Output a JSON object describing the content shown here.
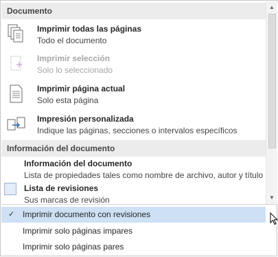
{
  "sections": [
    {
      "header": "Documento",
      "items": [
        {
          "title": "Imprimir todas las páginas",
          "desc": "Todo el documento",
          "icon": "pages-stack-icon",
          "disabled": false
        },
        {
          "title": "Imprimir selección",
          "desc": "Solo lo seleccionado",
          "icon": "selection-icon",
          "disabled": true
        },
        {
          "title": "Imprimir página actual",
          "desc": "Solo esta página",
          "icon": "single-page-icon",
          "disabled": false
        },
        {
          "title": "Impresión personalizada",
          "desc": "Indique las páginas, secciones o intervalos específicos",
          "icon": "custom-pages-icon",
          "disabled": false
        }
      ]
    },
    {
      "header": "Información del documento",
      "items": [
        {
          "title": "Información del documento",
          "desc": "Lista de propiedades tales como nombre de archivo, autor y título"
        },
        {
          "title": "Lista de revisiones",
          "desc": "Sus marcas de revisión"
        }
      ]
    }
  ],
  "options": [
    {
      "label": "Imprimir documento con revisiones",
      "checked": true
    },
    {
      "label": "Imprimir solo páginas impares",
      "checked": false
    },
    {
      "label": "Imprimir solo páginas pares",
      "checked": false
    }
  ],
  "check_glyph": "✓",
  "colors": {
    "section_bg": "#ececec",
    "selected_bg": "#cde0f4",
    "disabled_text": "#a6a6a6"
  }
}
